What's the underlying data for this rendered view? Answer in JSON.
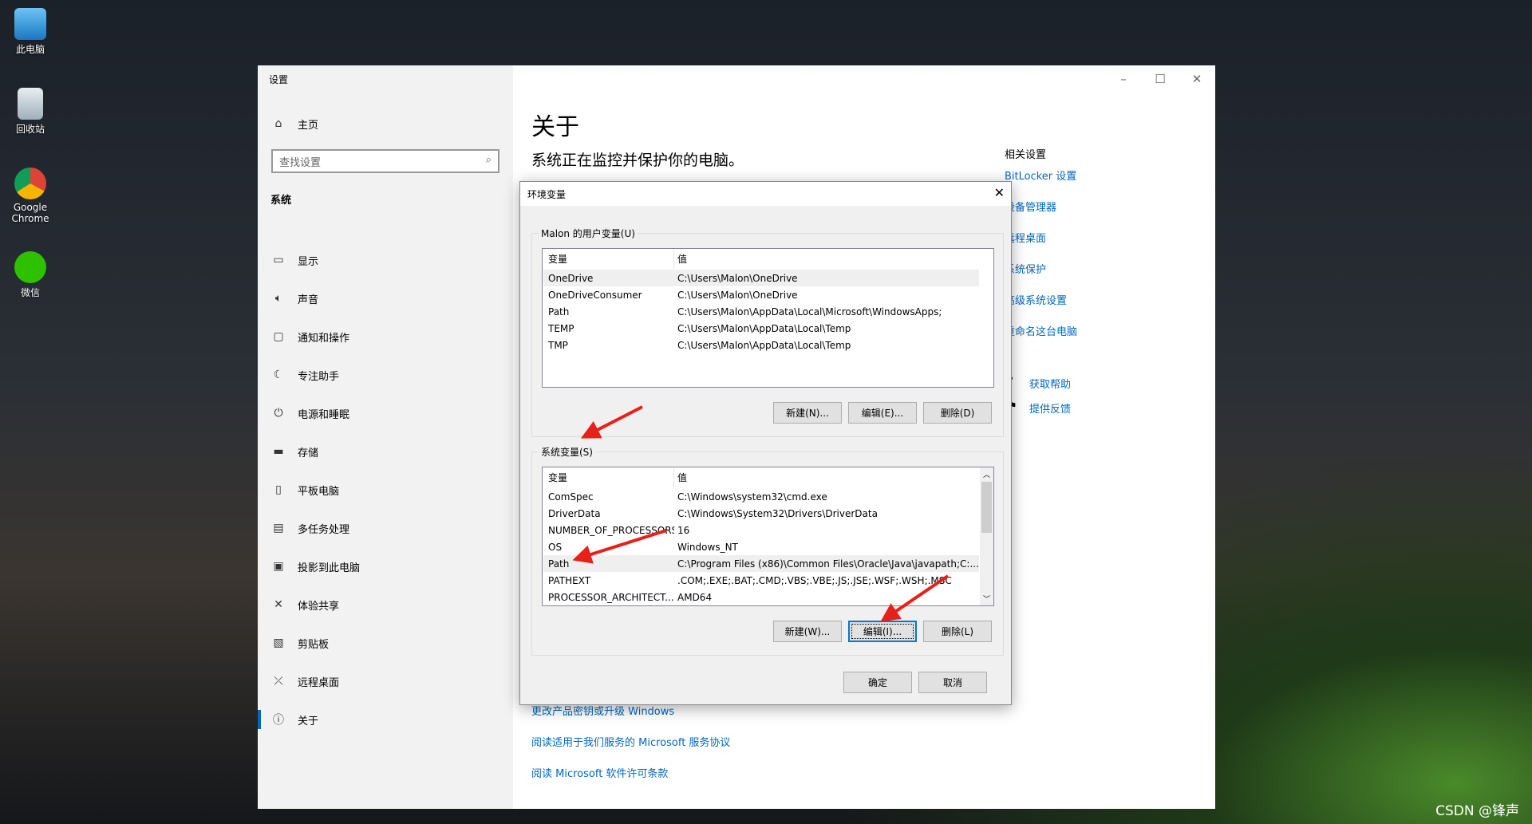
{
  "desktop": {
    "icons": [
      {
        "label": "此电脑",
        "icon": "computer-icon"
      },
      {
        "label": "回收站",
        "icon": "recycle-bin-icon"
      },
      {
        "label": "Google Chrome",
        "icon": "chrome-icon"
      },
      {
        "label": "微信",
        "icon": "wechat-icon"
      }
    ]
  },
  "settings": {
    "title": "设置",
    "home": "主页",
    "search_placeholder": "查找设置",
    "section": "系统",
    "nav": [
      {
        "label": "显示",
        "icon": "display-icon"
      },
      {
        "label": "声音",
        "icon": "sound-icon"
      },
      {
        "label": "通知和操作",
        "icon": "notification-icon"
      },
      {
        "label": "专注助手",
        "icon": "moon-icon"
      },
      {
        "label": "电源和睡眠",
        "icon": "power-icon"
      },
      {
        "label": "存储",
        "icon": "storage-icon"
      },
      {
        "label": "平板电脑",
        "icon": "tablet-icon"
      },
      {
        "label": "多任务处理",
        "icon": "multitask-icon"
      },
      {
        "label": "投影到此电脑",
        "icon": "project-icon"
      },
      {
        "label": "体验共享",
        "icon": "share-icon"
      },
      {
        "label": "剪贴板",
        "icon": "clipboard-icon"
      },
      {
        "label": "远程桌面",
        "icon": "remote-icon"
      },
      {
        "label": "关于",
        "icon": "info-icon",
        "selected": true
      }
    ],
    "page_title": "关于",
    "subtitle": "系统正在监控并保护你的电脑。",
    "related_title": "相关设置",
    "related_links": [
      "BitLocker 设置",
      "设备管理器",
      "远程桌面",
      "系统保护",
      "高级系统设置",
      "重命名这台电脑"
    ],
    "help_links": [
      "获取帮助",
      "提供反馈"
    ],
    "bottom_links": [
      "更改产品密钥或升级 Windows",
      "阅读适用于我们服务的 Microsoft 服务协议",
      "阅读 Microsoft 软件许可条款"
    ]
  },
  "dialog": {
    "title": "环境变量",
    "user_group": "Malon 的用户变量(U)",
    "columns": [
      "变量",
      "值"
    ],
    "user_vars": [
      [
        "OneDrive",
        "C:\\Users\\Malon\\OneDrive"
      ],
      [
        "OneDriveConsumer",
        "C:\\Users\\Malon\\OneDrive"
      ],
      [
        "Path",
        "C:\\Users\\Malon\\AppData\\Local\\Microsoft\\WindowsApps;"
      ],
      [
        "TEMP",
        "C:\\Users\\Malon\\AppData\\Local\\Temp"
      ],
      [
        "TMP",
        "C:\\Users\\Malon\\AppData\\Local\\Temp"
      ]
    ],
    "user_buttons": [
      "新建(N)...",
      "编辑(E)...",
      "删除(D)"
    ],
    "system_group": "系统变量(S)",
    "system_vars": [
      [
        "ComSpec",
        "C:\\Windows\\system32\\cmd.exe"
      ],
      [
        "DriverData",
        "C:\\Windows\\System32\\Drivers\\DriverData"
      ],
      [
        "NUMBER_OF_PROCESSORS",
        "16"
      ],
      [
        "OS",
        "Windows_NT"
      ],
      [
        "Path",
        "C:\\Program Files (x86)\\Common Files\\Oracle\\Java\\javapath;C:..."
      ],
      [
        "PATHEXT",
        ".COM;.EXE;.BAT;.CMD;.VBS;.VBE;.JS;.JSE;.WSF;.WSH;.MSC"
      ],
      [
        "PROCESSOR_ARCHITECT...",
        "AMD64"
      ]
    ],
    "system_buttons": [
      "新建(W)...",
      "编辑(I)...",
      "删除(L)"
    ],
    "ok": "确定",
    "cancel": "取消"
  },
  "annotation_color": "#e8201a",
  "watermark": "CSDN @锋声"
}
